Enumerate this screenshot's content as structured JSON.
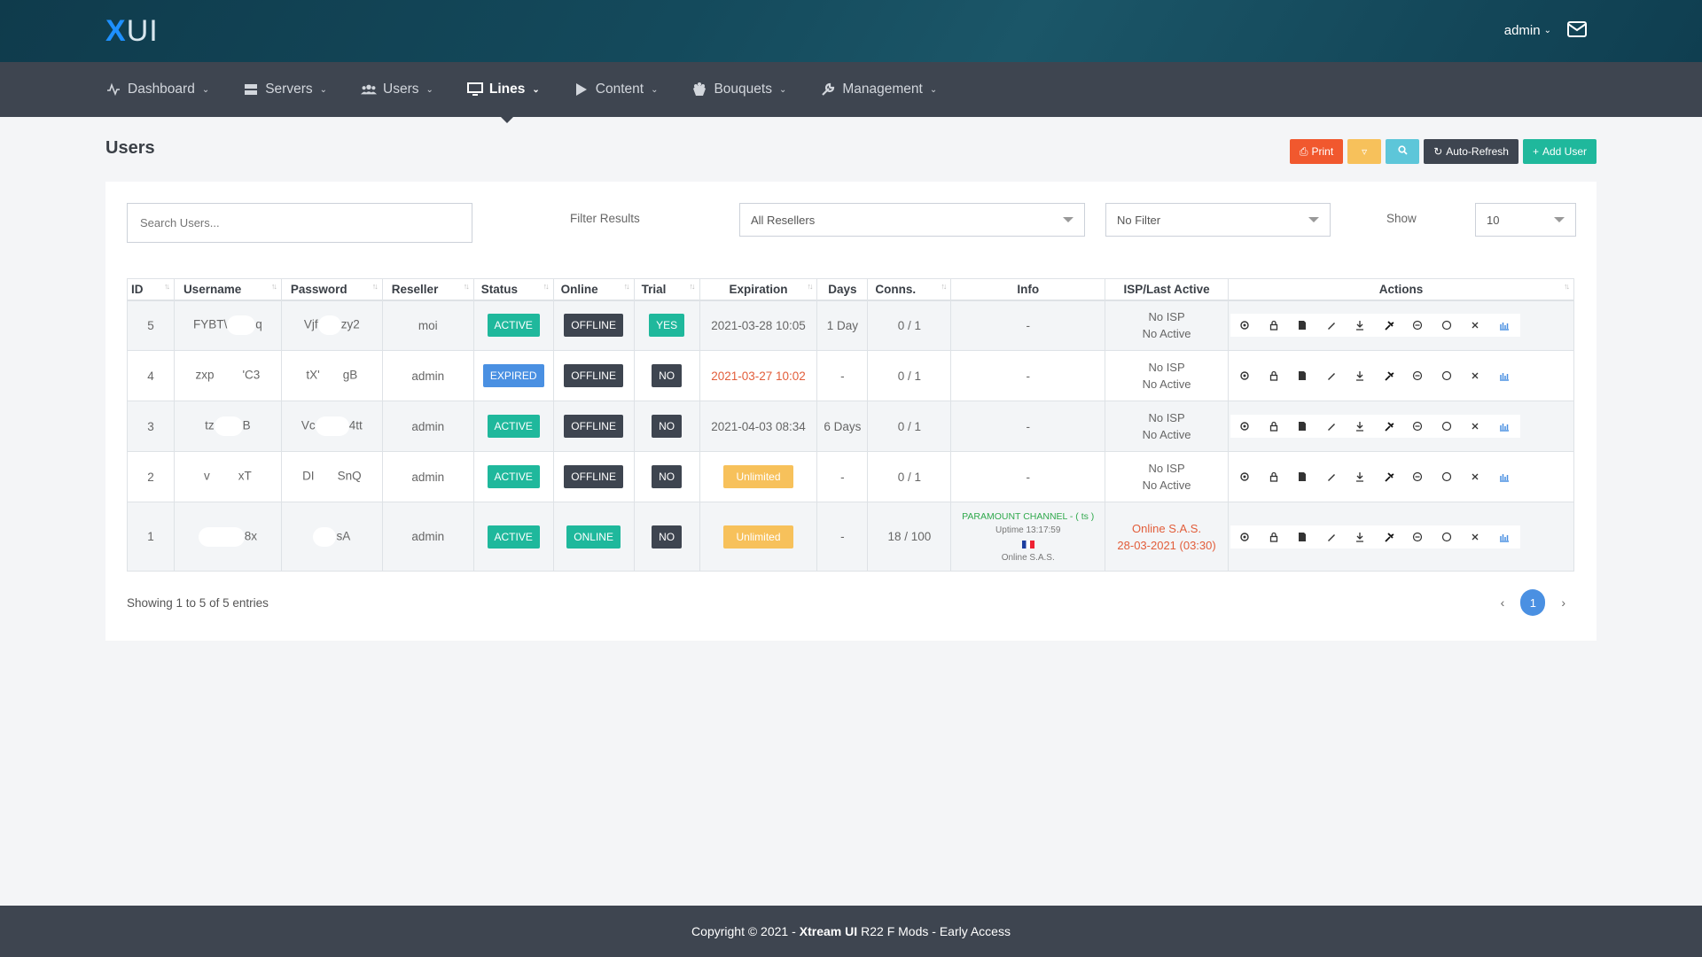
{
  "logo": {
    "x": "X",
    "ui": "UI"
  },
  "header": {
    "user": "admin"
  },
  "nav": [
    {
      "label": "Dashboard",
      "icon": "activity-icon"
    },
    {
      "label": "Servers",
      "icon": "server-icon"
    },
    {
      "label": "Users",
      "icon": "users-icon"
    },
    {
      "label": "Lines",
      "icon": "monitor-icon",
      "active": true
    },
    {
      "label": "Content",
      "icon": "play-icon"
    },
    {
      "label": "Bouquets",
      "icon": "bouquet-icon"
    },
    {
      "label": "Management",
      "icon": "wrench-icon"
    }
  ],
  "page": {
    "title": "Users"
  },
  "toolbar": {
    "print": "Print",
    "auto_refresh": "Auto-Refresh",
    "add_user": "Add User"
  },
  "filters": {
    "search_placeholder": "Search Users...",
    "filter_label": "Filter Results",
    "resellers": "All Resellers",
    "filter": "No Filter",
    "show_label": "Show",
    "show": "10"
  },
  "table": {
    "headers": [
      "ID",
      "Username",
      "Password",
      "Reseller",
      "Status",
      "Online",
      "Trial",
      "Expiration",
      "Days",
      "Conns.",
      "Info",
      "ISP/Last Active",
      "Actions"
    ],
    "rows": [
      {
        "id": "5",
        "u1": "FYBT\\",
        "u2": "q",
        "p1": "Vjf",
        "p2": "zy2",
        "reseller": "moi",
        "status": "ACTIVE",
        "online": "OFFLINE",
        "trial": "YES",
        "expiration": "2021-03-28 10:05",
        "days": "1 Day",
        "conns": "0 / 1",
        "info": "-",
        "isp1": "No ISP",
        "isp2": "No Active"
      },
      {
        "id": "4",
        "u1": "zxp",
        "u2": "'C3",
        "p1": "tX'",
        "p2": "gB",
        "reseller": "admin",
        "status": "EXPIRED",
        "online": "OFFLINE",
        "trial": "NO",
        "expiration": "2021-03-27 10:02",
        "days": "-",
        "conns": "0 / 1",
        "info": "-",
        "isp1": "No ISP",
        "isp2": "No Active"
      },
      {
        "id": "3",
        "u1": "tz",
        "u2": "B",
        "p1": "Vc",
        "p2": "4tt",
        "reseller": "admin",
        "status": "ACTIVE",
        "online": "OFFLINE",
        "trial": "NO",
        "expiration": "2021-04-03 08:34",
        "days": "6 Days",
        "conns": "0 / 1",
        "info": "-",
        "isp1": "No ISP",
        "isp2": "No Active"
      },
      {
        "id": "2",
        "u1": "v",
        "u2": "xT",
        "p1": "DI",
        "p2": "SnQ",
        "reseller": "admin",
        "status": "ACTIVE",
        "online": "OFFLINE",
        "trial": "NO",
        "expiration": "Unlimited",
        "days": "-",
        "conns": "0 / 1",
        "info": "-",
        "isp1": "No ISP",
        "isp2": "No Active"
      },
      {
        "id": "1",
        "u1": "",
        "u2": "8x",
        "p1": "",
        "p2": "sA",
        "reseller": "admin",
        "status": "ACTIVE",
        "online": "ONLINE",
        "trial": "NO",
        "expiration": "Unlimited",
        "days": "-",
        "conns": "18 / 100",
        "info_channel": "PARAMOUNT CHANNEL - ( ts )",
        "info_uptime": "Uptime 13:17:59",
        "info_isp": "Online S.A.S.",
        "isp1": "Online S.A.S.",
        "isp2": "28-03-2021 (03:30)"
      }
    ]
  },
  "pagination": {
    "showing": "Showing 1 to 5 of 5 entries",
    "prev": "‹",
    "page": "1",
    "next": "›"
  },
  "footer": {
    "pre": "Copyright © 2021 -",
    "brand": "Xtream UI",
    "post": "R22 F Mods - Early Access"
  }
}
